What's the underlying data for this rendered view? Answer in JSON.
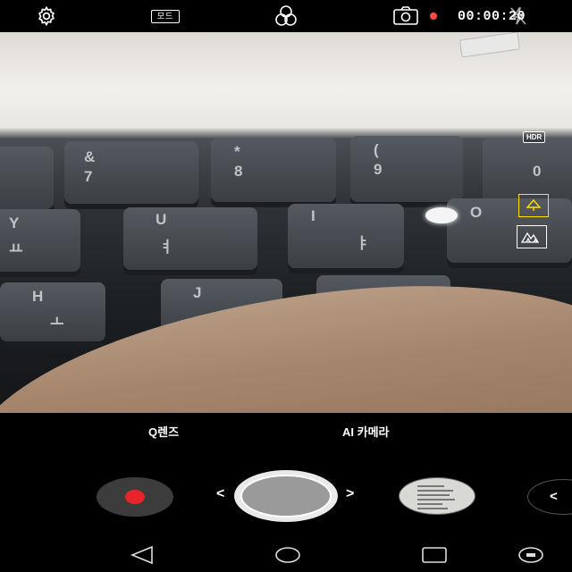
{
  "top_bar": {
    "settings_icon": "gear-icon",
    "mode_label": "모드",
    "filter_icon": "three-circles-filter-icon",
    "snapshot_icon": "camera-capture-icon",
    "recording_indicator_color": "#ff4a3d",
    "timer": "00:00:20",
    "flash_icon": "flash-off-icon"
  },
  "viewfinder": {
    "hdr_badge": "HDR",
    "scene_buttons": [
      {
        "name": "ai-scene-icon",
        "active": true,
        "color": "#ffe000"
      },
      {
        "name": "landscape-scene-icon",
        "active": false,
        "color": "#ffffff"
      }
    ]
  },
  "bottom": {
    "lens_left": "Q렌즈",
    "lens_right": "AI 카메라",
    "record_color": "#e8232a",
    "prev_chevron": "<",
    "next_chevron": ">",
    "collapse_chevron": "<"
  },
  "nav": {
    "back_icon": "back-triangle-icon",
    "home_icon": "home-circle-icon",
    "recents_icon": "recents-square-icon",
    "extra_icon": "dual-screen-icon"
  }
}
